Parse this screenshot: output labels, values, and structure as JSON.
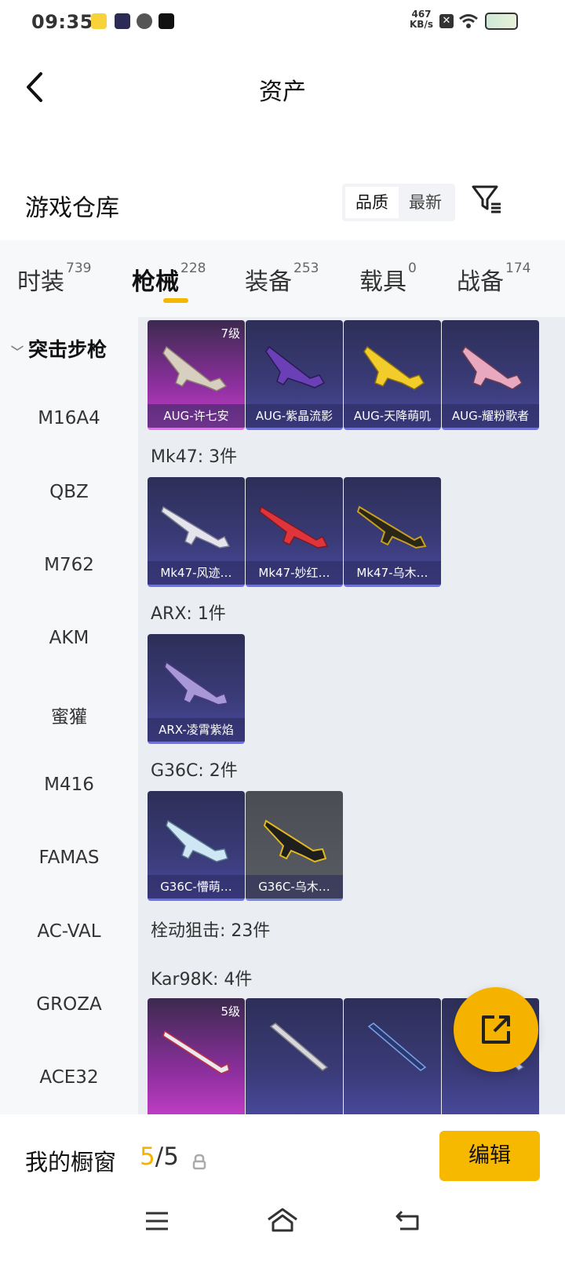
{
  "status": {
    "time": "09:35",
    "network_speed_value": "467",
    "network_speed_unit": "KB/s",
    "app_icons": [
      "meituan-icon",
      "video-app-icon",
      "sync-app-icon",
      "tiktok-icon"
    ]
  },
  "header": {
    "title": "资产"
  },
  "warehouse": {
    "title": "游戏仓库",
    "sort_options": [
      "品质",
      "最新"
    ],
    "selected_sort": "品质"
  },
  "tabs": [
    {
      "label": "时装",
      "count": "739"
    },
    {
      "label": "枪械",
      "count": "228"
    },
    {
      "label": "装备",
      "count": "253"
    },
    {
      "label": "载具",
      "count": "0"
    },
    {
      "label": "战备",
      "count": "174"
    }
  ],
  "active_tab": "枪械",
  "sidebar": {
    "category": "突击步枪",
    "items": [
      "M16A4",
      "QBZ",
      "M762",
      "AKM",
      "蜜獾",
      "M416",
      "FAMAS",
      "AC-VAL",
      "GROZA",
      "ACE32"
    ]
  },
  "groups": [
    {
      "heading": "",
      "items": [
        {
          "name": "AUG-许七安",
          "level": "7级",
          "rarity": "pink"
        },
        {
          "name": "AUG-紫晶流影",
          "rarity": "purple"
        },
        {
          "name": "AUG-天降萌叽",
          "rarity": "purple"
        },
        {
          "name": "AUG-耀粉歌者",
          "rarity": "purple"
        }
      ]
    },
    {
      "heading": "Mk47: 3件",
      "items": [
        {
          "name": "Mk47-风迹…",
          "rarity": "purple"
        },
        {
          "name": "Mk47-妙红…",
          "rarity": "purple"
        },
        {
          "name": "Mk47-乌木…",
          "rarity": "purple"
        }
      ]
    },
    {
      "heading": "ARX: 1件",
      "items": [
        {
          "name": "ARX-凌霄紫焰",
          "rarity": "purple"
        }
      ]
    },
    {
      "heading": "G36C: 2件",
      "items": [
        {
          "name": "G36C-懵萌…",
          "rarity": "purple"
        },
        {
          "name": "G36C-乌木…",
          "rarity": "grey"
        }
      ]
    }
  ],
  "section2": {
    "heading": "栓动狙击: 23件"
  },
  "kar_group": {
    "heading": "Kar98K: 4件",
    "items": [
      {
        "level": "5级",
        "rarity": "pink"
      },
      {
        "rarity": "purple"
      },
      {
        "rarity": "purple"
      },
      {
        "rarity": "purple"
      }
    ]
  },
  "showcase": {
    "label": "我的橱窗",
    "used": "5",
    "separator": "/",
    "total": "5",
    "edit_label": "编辑"
  },
  "colors": {
    "accent": "#f5b300",
    "background": "#ffffff",
    "content_bg": "#eaedf2"
  }
}
